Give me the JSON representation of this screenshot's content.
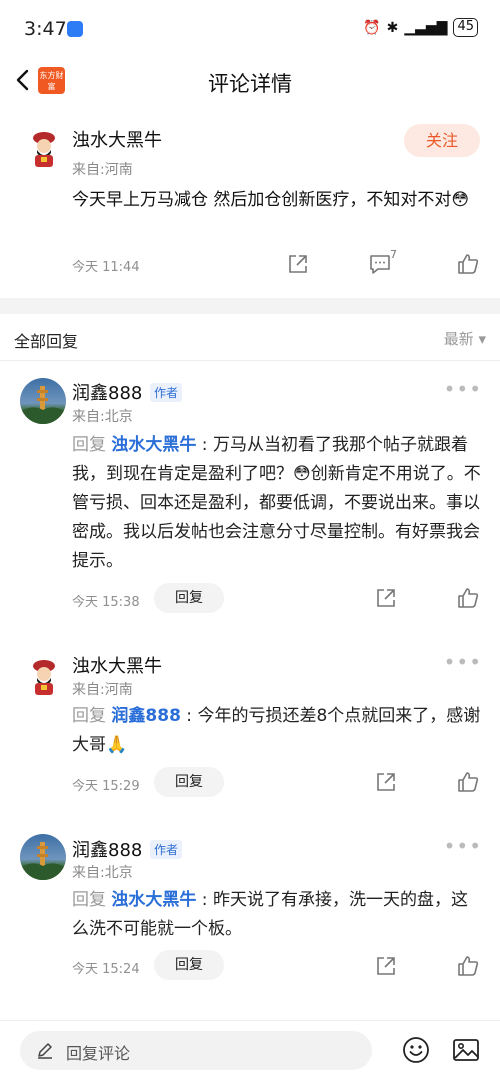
{
  "status": {
    "time": "3:47",
    "battery": "45"
  },
  "header": {
    "title": "评论详情",
    "logo_text": "东方财富"
  },
  "post": {
    "author": "浊水大黑牛",
    "from": "来自:河南",
    "follow_label": "关注",
    "content": "今天早上万马减仓  然后加仓创新医疗，不知对不对😳",
    "time": "今天 11:44",
    "comment_count": "7"
  },
  "replies_section": {
    "title": "全部回复",
    "sort_label": "最新 ▾"
  },
  "replies": [
    {
      "author": "润鑫888",
      "tag": "作者",
      "from": "来自:北京",
      "prefix": "回复 ",
      "target": "浊水大黑牛",
      "text": " : 万马从当初看了我那个帖子就跟着我，到现在肯定是盈利了吧？😳创新肯定不用说了。不管亏损、回本还是盈利，都要低调，不要说出来。事以密成。我以后发帖也会注意分寸尽量控制。有好票我会提示。",
      "time": "今天 15:38",
      "reply_label": "回复"
    },
    {
      "author": "浊水大黑牛",
      "from": "来自:河南",
      "prefix": "回复 ",
      "target": "润鑫888",
      "text": " : 今年的亏损还差8个点就回来了，感谢大哥🙏",
      "time": "今天 15:29",
      "reply_label": "回复"
    },
    {
      "author": "润鑫888",
      "tag": "作者",
      "from": "来自:北京",
      "prefix": "回复 ",
      "target": "浊水大黑牛",
      "text": " : 昨天说了有承接，洗一天的盘，这么洗不可能就一个板。",
      "time": "今天 15:24",
      "reply_label": "回复"
    }
  ],
  "bottom": {
    "placeholder": "回复评论"
  },
  "colors": {
    "accent": "#e85a2a",
    "link": "#2a6ed8"
  }
}
